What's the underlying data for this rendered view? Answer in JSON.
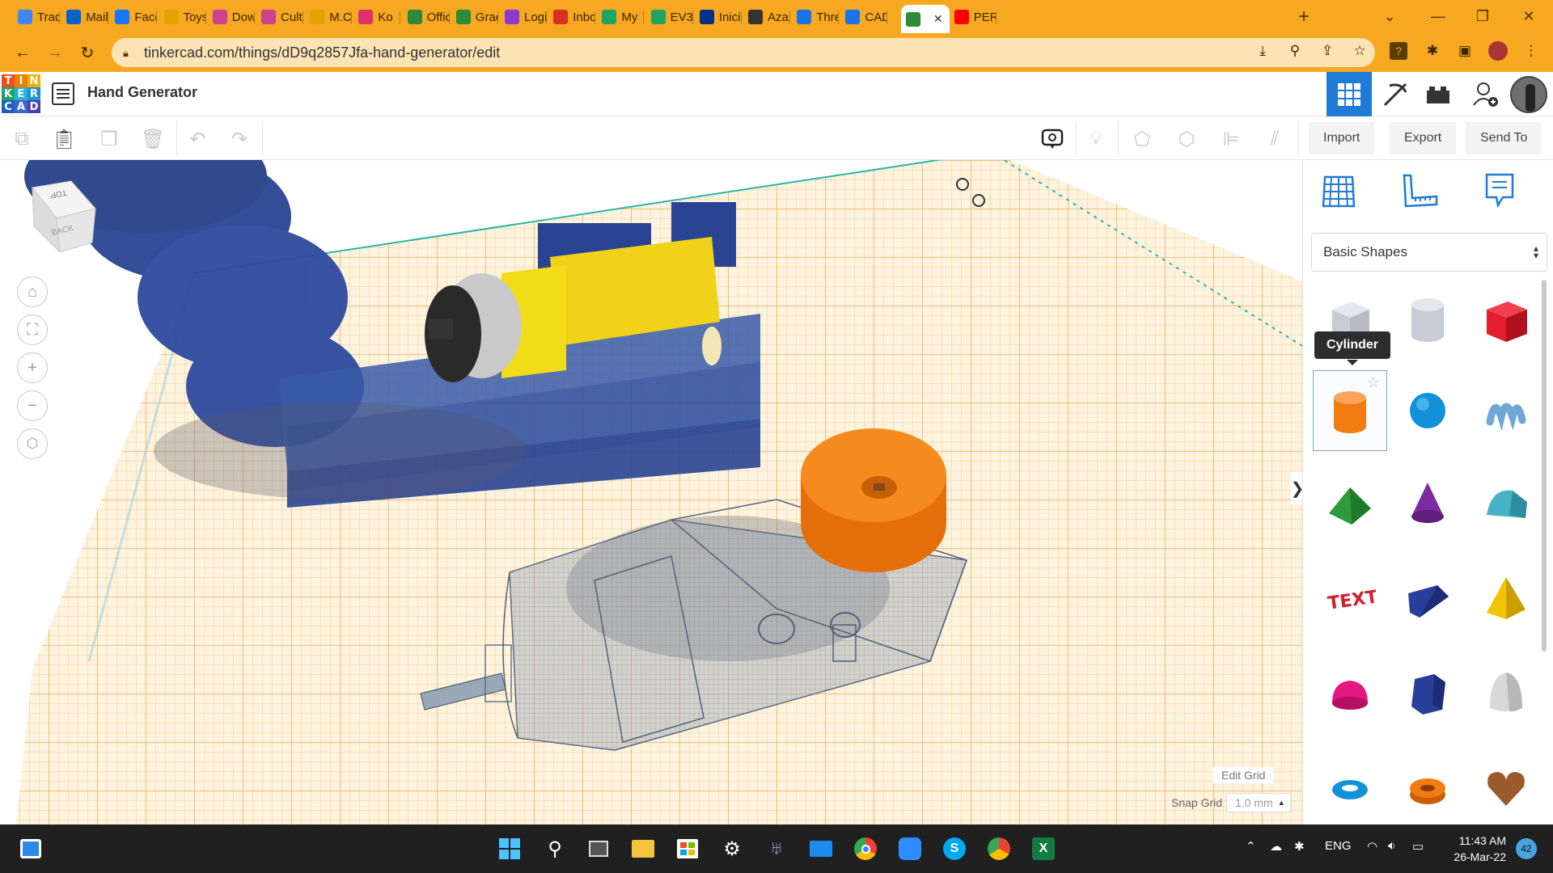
{
  "browser": {
    "tabs": [
      {
        "label": "Trad",
        "icon": "translate-icon",
        "color": "#4285f4"
      },
      {
        "label": "Mail",
        "icon": "outlook-icon",
        "color": "#0a64c8"
      },
      {
        "label": "Face",
        "icon": "facebook-icon",
        "color": "#1877f2"
      },
      {
        "label": "Toys",
        "icon": "toys-icon",
        "color": "#e2a200"
      },
      {
        "label": "Dow",
        "icon": "download-site-icon",
        "color": "#d04090"
      },
      {
        "label": "Cult",
        "icon": "culture-site-icon",
        "color": "#d04090"
      },
      {
        "label": "M.C",
        "icon": "mc-site-icon",
        "color": "#e2a200"
      },
      {
        "label": "Ko",
        "icon": "kahoot-icon",
        "color": "#e0306a"
      },
      {
        "label": "Offic",
        "icon": "tinkercad-office-icon",
        "color": "#2f8a3a"
      },
      {
        "label": "Grac",
        "icon": "tinkercad-grade-icon",
        "color": "#2f8a3a"
      },
      {
        "label": "Logi",
        "icon": "login-icon",
        "color": "#8a3ad0"
      },
      {
        "label": "Inbo",
        "icon": "gmail-icon",
        "color": "#d93025"
      },
      {
        "label": "My",
        "icon": "drive-icon",
        "color": "#1fa463"
      },
      {
        "label": "EV3",
        "icon": "drive-ev3-icon",
        "color": "#1fa463"
      },
      {
        "label": "Inici",
        "icon": "paypal-icon",
        "color": "#003087"
      },
      {
        "label": "Azar",
        "icon": "wikipedia-icon",
        "color": "#333333"
      },
      {
        "label": "Thre",
        "icon": "threads-icon",
        "color": "#1a73e8"
      },
      {
        "label": "CAD",
        "icon": "cad-icon",
        "color": "#1a73e8"
      },
      {
        "label": "",
        "icon": "tinkercad-tab-icon",
        "color": "#2f8a3a",
        "active": true
      },
      {
        "label": "PER",
        "icon": "youtube-icon",
        "color": "#ff0000"
      }
    ],
    "new_tab": "+",
    "url": "tinkercad.com/things/dD9q2857Jfa-hand-generator/edit"
  },
  "app": {
    "logo_letters": [
      "T",
      "I",
      "N",
      "K",
      "E",
      "R",
      "C",
      "A",
      "D"
    ],
    "logo_colors": [
      "#e94e1b",
      "#ef7d00",
      "#f6b100",
      "#1fa463",
      "#23b5d3",
      "#1f8fd6",
      "#1f5fbf",
      "#3a66c8",
      "#4a3fb0"
    ],
    "title": "Hand Generator",
    "buttons": {
      "import": "Import",
      "export": "Export",
      "send_to": "Send To"
    },
    "accent": "#1f7bd6"
  },
  "panel": {
    "category": "Basic Shapes",
    "tooltip": "Cylinder",
    "shapes": [
      {
        "name": "box-hole",
        "color": "#c8ccd4"
      },
      {
        "name": "cylinder-hole",
        "color": "#c8ccd4"
      },
      {
        "name": "box",
        "color": "#e21d2c"
      },
      {
        "name": "cylinder",
        "color": "#f07c12"
      },
      {
        "name": "sphere",
        "color": "#1391d8"
      },
      {
        "name": "scribble",
        "color": "#6fa7d6"
      },
      {
        "name": "roof",
        "color": "#2f9a3a"
      },
      {
        "name": "cone",
        "color": "#7b2ca0"
      },
      {
        "name": "round-roof",
        "color": "#47b3c6"
      },
      {
        "name": "text",
        "color": "#d1202e"
      },
      {
        "name": "wedge",
        "color": "#2a3f9a"
      },
      {
        "name": "pyramid",
        "color": "#f2c400"
      },
      {
        "name": "half-sphere",
        "color": "#e2177f"
      },
      {
        "name": "polygon",
        "color": "#2a3f9a"
      },
      {
        "name": "paraboloid",
        "color": "#d8d8d8"
      },
      {
        "name": "torus",
        "color": "#1391d8"
      },
      {
        "name": "tube",
        "color": "#f07c12"
      },
      {
        "name": "heart",
        "color": "#9b5a2e"
      }
    ]
  },
  "viewport": {
    "viewcube": {
      "top": "TOP",
      "back": "BACK"
    },
    "edit_grid": "Edit Grid",
    "snap_grid_label": "Snap Grid",
    "snap_grid_value": "1.0 mm"
  },
  "taskbar": {
    "language": "ENG",
    "time": "11:43 AM",
    "date": "26-Mar-22",
    "notifications": "42"
  }
}
